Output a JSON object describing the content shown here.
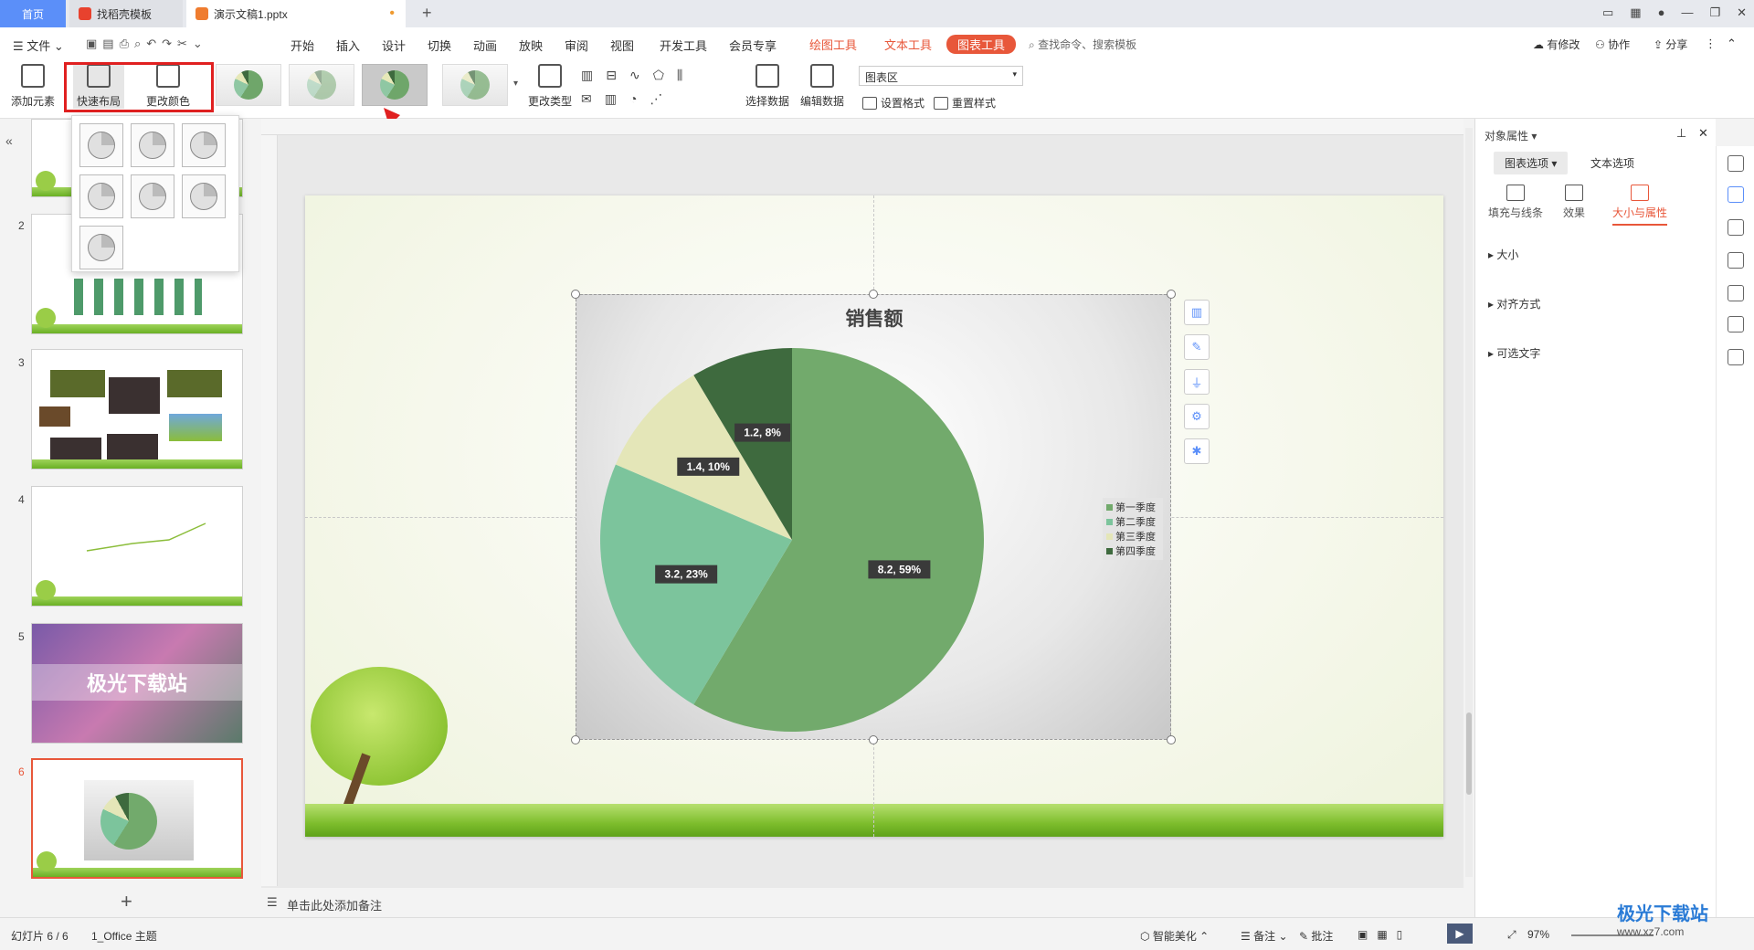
{
  "titlebar": {
    "tabs": [
      {
        "label": "首页"
      },
      {
        "label": "找稻壳模板"
      },
      {
        "label": "演示文稿1.pptx"
      }
    ],
    "new_tab": "+"
  },
  "menubar": {
    "file_label": "文件",
    "items": [
      "开始",
      "插入",
      "设计",
      "切换",
      "动画",
      "放映",
      "审阅",
      "视图",
      "开发工具",
      "会员专享"
    ],
    "context_tabs": [
      "绘图工具",
      "文本工具",
      "图表工具"
    ],
    "search_placeholder": "查找命令、搜索模板",
    "right": [
      "有修改",
      "协作",
      "分享"
    ]
  },
  "ribbon": {
    "add_element": "添加元素",
    "quick_layout": "快速布局",
    "change_color": "更改颜色",
    "change_type": "更改类型",
    "select_data": "选择数据",
    "edit_data": "编辑数据",
    "chart_area_select": "图表区",
    "set_format": "设置格式",
    "reset_style": "重置样式"
  },
  "slides": {
    "numbers": [
      "2",
      "3",
      "4",
      "5",
      "6"
    ],
    "slide5_text": "极光下载站"
  },
  "chart_data": {
    "type": "pie",
    "title": "销售额",
    "categories": [
      "第一季度",
      "第二季度",
      "第三季度",
      "第四季度"
    ],
    "values": [
      8.2,
      3.2,
      1.4,
      1.2
    ],
    "percents": [
      59,
      23,
      10,
      8
    ],
    "data_labels": [
      "8.2, 59%",
      "3.2, 23%",
      "1.4, 10%",
      "1.2, 8%"
    ],
    "colors": [
      "#72aa6c",
      "#7cc49c",
      "#e4e6b8",
      "#3e6a3e"
    ],
    "legend_position": "right"
  },
  "notes_placeholder": "单击此处添加备注",
  "rightpanel": {
    "title": "对象属性",
    "tabs": [
      "图表选项",
      "文本选项"
    ],
    "subtabs": [
      "填充与线条",
      "效果",
      "大小与属性"
    ],
    "sections": [
      "大小",
      "对齐方式",
      "可选文字"
    ]
  },
  "statusbar": {
    "slide_info": "幻灯片 6 / 6",
    "theme": "1_Office 主题",
    "beautify": "智能美化",
    "notes": "备注",
    "comments": "批注",
    "zoom": "97%"
  },
  "watermark": {
    "name": "极光下载站",
    "url": "www.xz7.com"
  }
}
